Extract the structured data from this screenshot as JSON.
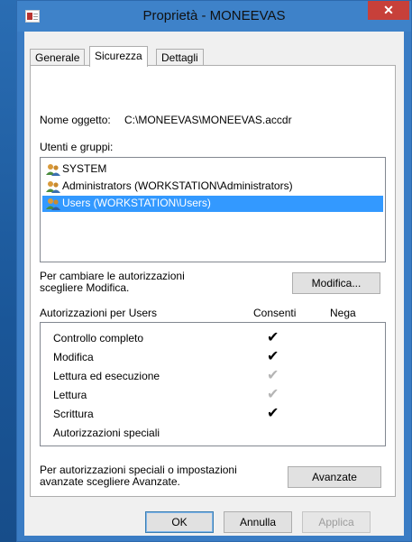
{
  "window": {
    "title": "Proprietà - MONEEVAS",
    "close_label": "✕",
    "icon": "access-file-icon"
  },
  "tabs": [
    {
      "label": "Generale",
      "active": false
    },
    {
      "label": "Sicurezza",
      "active": true
    },
    {
      "label": "Dettagli",
      "active": false
    }
  ],
  "security": {
    "object_name_label": "Nome oggetto:",
    "object_name_value": "C:\\MONEEVAS\\MONEEVAS.accdr",
    "groups_label": "Utenti e gruppi:",
    "groups": [
      {
        "name": "SYSTEM",
        "icon": "users-group-icon",
        "selected": false
      },
      {
        "name": "Administrators (WORKSTATION\\Administrators)",
        "icon": "users-group-icon",
        "selected": false
      },
      {
        "name": "Users (WORKSTATION\\Users)",
        "icon": "users-group-icon",
        "selected": true
      }
    ],
    "change_hint_line1": "Per cambiare le autorizzazioni",
    "change_hint_line2": "scegliere Modifica.",
    "edit_button": "Modifica...",
    "permissions_label": "Autorizzazioni per Users",
    "allow_header": "Consenti",
    "deny_header": "Nega",
    "permissions": [
      {
        "name": "Controllo completo",
        "allow": "✔",
        "allow_state": "checked"
      },
      {
        "name": "Modifica",
        "allow": "✔",
        "allow_state": "checked"
      },
      {
        "name": "Lettura ed esecuzione",
        "allow": "✔",
        "allow_state": "inherited"
      },
      {
        "name": "Lettura",
        "allow": "✔",
        "allow_state": "inherited"
      },
      {
        "name": "Scrittura",
        "allow": "✔",
        "allow_state": "checked"
      },
      {
        "name": "Autorizzazioni speciali",
        "allow": "",
        "allow_state": "none"
      }
    ],
    "advanced_hint_line1": "Per autorizzazioni speciali o impostazioni",
    "advanced_hint_line2": "avanzate scegliere Avanzate.",
    "advanced_button": "Avanzate"
  },
  "footer": {
    "ok": "OK",
    "cancel": "Annulla",
    "apply": "Applica"
  },
  "colors": {
    "selection": "#3399ff",
    "close_button": "#c7403a",
    "titlebar": "#3e82c9"
  }
}
